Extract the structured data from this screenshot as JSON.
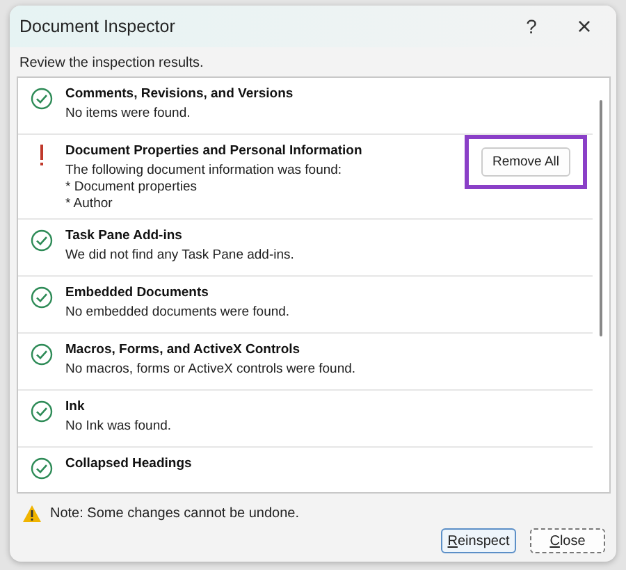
{
  "window": {
    "title": "Document Inspector",
    "help": "?",
    "close": "×"
  },
  "instruction": "Review the inspection results.",
  "results": [
    {
      "kind": "ok",
      "title": "Comments, Revisions, and Versions",
      "lines": [
        "No items were found."
      ]
    },
    {
      "kind": "warning",
      "title": "Document Properties and Personal Information",
      "lines": [
        "The following document information was found:",
        "* Document properties",
        "* Author"
      ],
      "action": {
        "label": "Remove All",
        "highlighted": true
      }
    },
    {
      "kind": "ok",
      "title": "Task Pane Add-ins",
      "lines": [
        "We did not find any Task Pane add-ins."
      ]
    },
    {
      "kind": "ok",
      "title": "Embedded Documents",
      "lines": [
        "No embedded documents were found."
      ]
    },
    {
      "kind": "ok",
      "title": "Macros, Forms, and ActiveX Controls",
      "lines": [
        "No macros, forms or ActiveX controls were found."
      ]
    },
    {
      "kind": "ok",
      "title": "Ink",
      "lines": [
        "No Ink was found."
      ]
    },
    {
      "kind": "ok",
      "title": "Collapsed Headings"
    }
  ],
  "note": "Note: Some changes cannot be undone.",
  "buttons": [
    {
      "label": "Reinspect",
      "default": true
    },
    {
      "label": "Close",
      "default": false
    }
  ]
}
